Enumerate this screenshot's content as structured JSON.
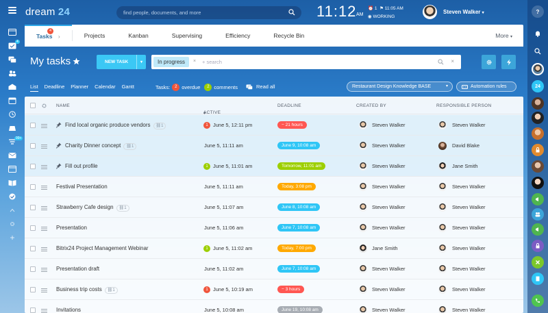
{
  "app": {
    "logo_text": "dream",
    "logo_num": "24",
    "search_placeholder": "find people, documents, and more",
    "time": "11:12",
    "ampm": "AM",
    "clock_count": "1",
    "clock_day": "11:05 AM",
    "status": "WORKING",
    "user_name": "Steven Walker"
  },
  "left_sidebar": {
    "badges": {
      "tasks": "4",
      "activity": "99+"
    }
  },
  "tabs": [
    {
      "label": "Tasks",
      "badge": "4"
    },
    {
      "label": "Projects"
    },
    {
      "label": "Kanban"
    },
    {
      "label": "Supervising"
    },
    {
      "label": "Efficiency"
    },
    {
      "label": "Recycle Bin"
    }
  ],
  "more_label": "More",
  "page_title": "My tasks",
  "new_task_label": "NEW TASK",
  "filter": {
    "chip": "In progress",
    "placeholder": "+ search"
  },
  "views": [
    "List",
    "Deadline",
    "Planner",
    "Calendar",
    "Gantt"
  ],
  "counters": {
    "prefix": "Tasks:",
    "overdue_count": "2",
    "overdue_label": "overdue",
    "comments_count": "2",
    "comments_label": "comments",
    "read_all": "Read all"
  },
  "knowledge_base": "Restaurant Design Knowledge BASE",
  "automation_rules": "Automation rules",
  "table": {
    "headers": {
      "name": "NAME",
      "active": "ACTIVE",
      "deadline": "DEADLINE",
      "created_by": "CREATED BY",
      "responsible": "RESPONSIBLE PERSON"
    },
    "rows": [
      {
        "name": "Find local organic produce vendors",
        "links": "1",
        "active": "June 5, 12:11 pm",
        "active_badge": "1",
        "active_badge_color": "#f0553c",
        "deadline": "− 21 hours",
        "deadline_color": "#ff5752",
        "created_by": "Steven Walker",
        "responsible": "Steven Walker",
        "pinned": true
      },
      {
        "name": "Charity Dinner concept",
        "links": "1",
        "active": "June 5, 11:11 am",
        "deadline": "June 9, 10:08 am",
        "deadline_color": "#2fc6f6",
        "created_by": "Steven Walker",
        "responsible": "David Blake",
        "pinned": true
      },
      {
        "name": "Fill out profile",
        "active": "June 5, 11:01 am",
        "active_badge": "1",
        "active_badge_color": "#9dcf00",
        "deadline": "Tomorrow, 11:01 am",
        "deadline_color": "#9dcf00",
        "created_by": "Steven Walker",
        "responsible": "Jane Smith",
        "pinned": true
      },
      {
        "name": "Festival Presentation",
        "active": "June 5, 11:11 am",
        "deadline": "Today, 3:08 pm",
        "deadline_color": "#ffa900",
        "created_by": "Steven Walker",
        "responsible": "Steven Walker"
      },
      {
        "name": "Strawberry Cafe design",
        "links": "1",
        "active": "June 5, 11:07 am",
        "deadline": "June 8, 10:08 am",
        "deadline_color": "#2fc6f6",
        "created_by": "Steven Walker",
        "responsible": "Steven Walker"
      },
      {
        "name": "Presentation",
        "active": "June 5, 11:06 am",
        "deadline": "June 7, 10:08 am",
        "deadline_color": "#2fc6f6",
        "created_by": "Steven Walker",
        "responsible": "Steven Walker"
      },
      {
        "name": "Bitrix24 Project Management Webinar",
        "active": "June 5, 11:02 am",
        "active_badge": "1",
        "active_badge_color": "#9dcf00",
        "deadline": "Today, 7:00 pm",
        "deadline_color": "#ffa900",
        "created_by": "Jane Smith",
        "responsible": "Steven Walker"
      },
      {
        "name": "Presentation draft",
        "active": "June 5, 11:02 am",
        "deadline": "June 7, 10:08 am",
        "deadline_color": "#2fc6f6",
        "created_by": "Steven Walker",
        "responsible": "Steven Walker"
      },
      {
        "name": "Business trip costs",
        "links": "1",
        "active": "June 5, 10:19 am",
        "active_badge": "1",
        "active_badge_color": "#f0553c",
        "deadline": "− 3 hours",
        "deadline_color": "#ff5752",
        "created_by": "Steven Walker",
        "responsible": "Steven Walker"
      },
      {
        "name": "Invitations",
        "active": "June 5, 10:08 am",
        "deadline": "June 19, 10:08 am",
        "deadline_color": "#a8adb4",
        "created_by": "Steven Walker",
        "responsible": "Steven Walker"
      }
    ]
  },
  "colors": {
    "accent": "#3bc8f5",
    "overdue": "#f0553c",
    "comments": "#9dcf00"
  }
}
